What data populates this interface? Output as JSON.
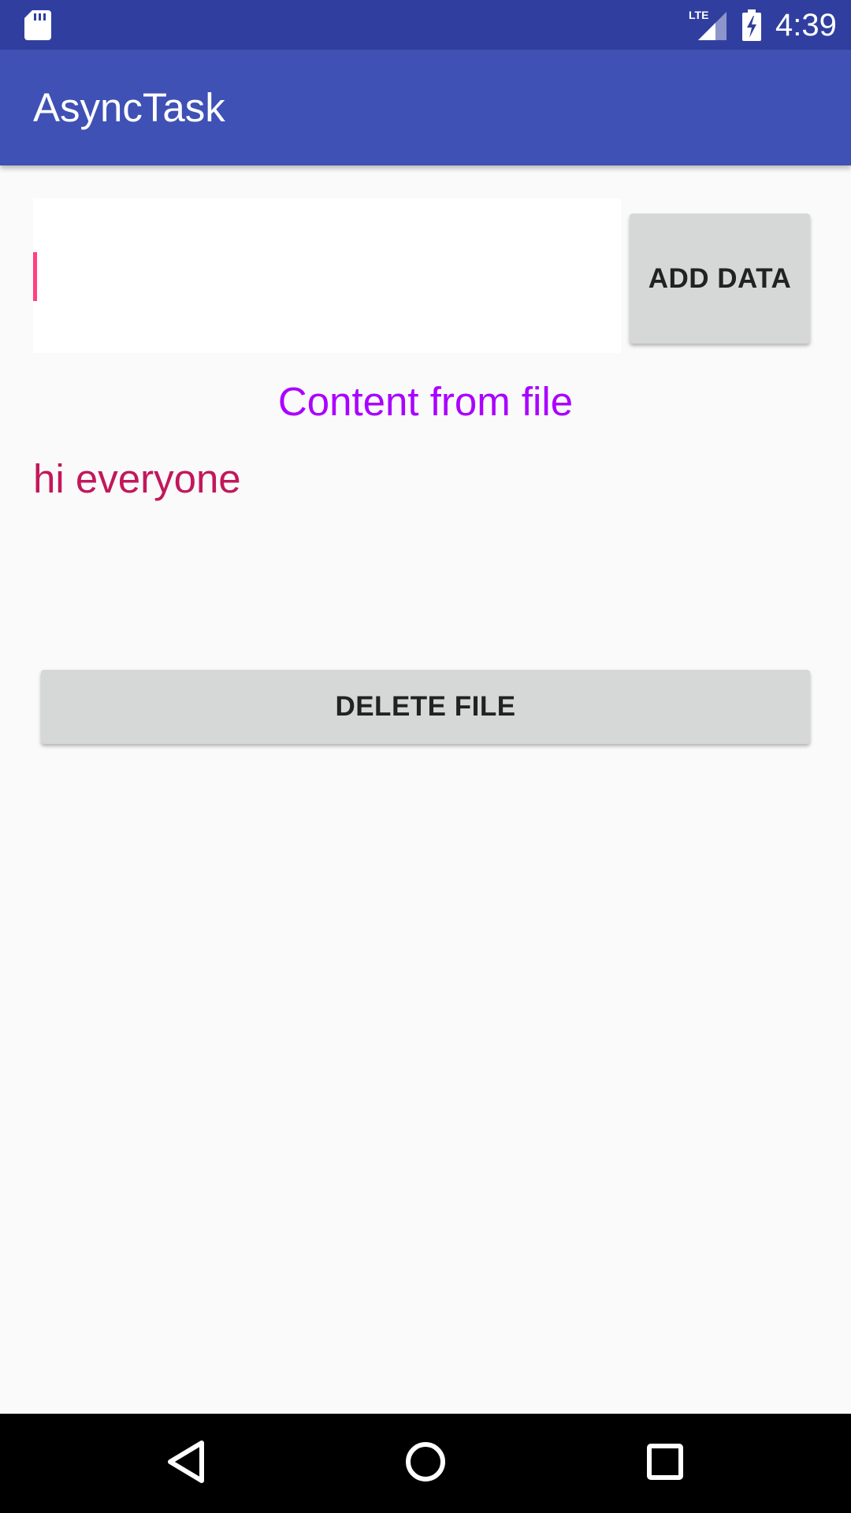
{
  "status_bar": {
    "time": "4:39",
    "network_label": "LTE",
    "icons": [
      "sd-card-icon",
      "lte-signal-icon",
      "battery-charging-icon"
    ]
  },
  "app_bar": {
    "title": "AsyncTask"
  },
  "form": {
    "input_value": "",
    "add_button_label": "ADD DATA"
  },
  "content": {
    "label": "Content from file",
    "file_text": "hi everyone"
  },
  "actions": {
    "delete_button_label": "DELETE FILE"
  },
  "nav_bar": {
    "icons": [
      "back-icon",
      "home-icon",
      "recents-icon"
    ]
  },
  "colors": {
    "status_bar": "#303f9f",
    "app_bar": "#3f51b5",
    "accent": "#ff4081",
    "content_label": "#aa00ff",
    "file_text": "#c2185b",
    "button": "#d6d7d7",
    "background": "#fafafa"
  }
}
